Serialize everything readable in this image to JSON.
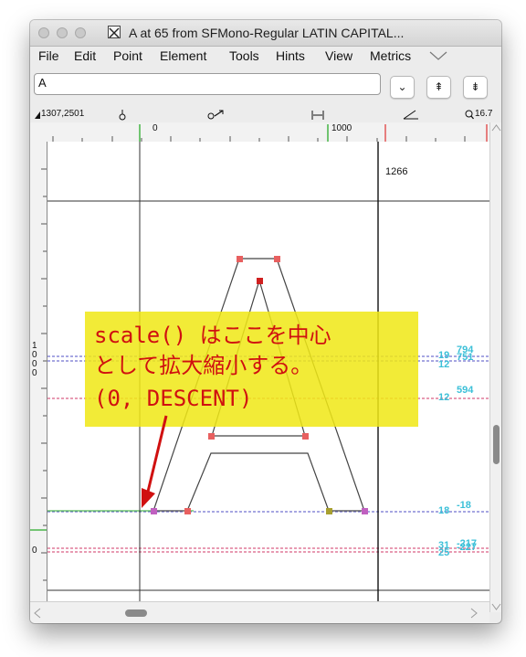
{
  "window": {
    "title": "A at 65 from SFMono-Regular LATIN CAPITAL..."
  },
  "menu": [
    "File",
    "Edit",
    "Point",
    "Element",
    "Tools",
    "Hints",
    "View",
    "Metrics"
  ],
  "toolbar": {
    "glyph_name": "A",
    "buttons": [
      "⌄",
      "⇞",
      "⇟"
    ]
  },
  "info": {
    "coords": "1307,2501",
    "zoom": "16.7"
  },
  "ruler": {
    "top_labels": [
      "0",
      "1000"
    ],
    "left_labels": [
      "1",
      "0",
      "0",
      "0",
      "0"
    ]
  },
  "canvas": {
    "advance_label": "1266",
    "metric_labels": [
      {
        "a": "19",
        "b": "794"
      },
      {
        "a": "12",
        "b": "751"
      },
      {
        "a": "12",
        "b": "594"
      },
      {
        "a": "18",
        "b": "-18"
      },
      {
        "a": "31",
        "b": "-217"
      },
      {
        "a": "25",
        "b": "-227"
      }
    ]
  },
  "callout": {
    "line1": "scale() はここを中心",
    "line2": "として拡大縮小する。",
    "line3": "(0, DESCENT)"
  },
  "colors": {
    "callout_bg": "#f0e816",
    "callout_text": "#d01010",
    "metric_cyan": "#3cc0d8",
    "guide_blue": "#8a8ad8",
    "guide_pink": "#e07a9a",
    "baseline_green": "#2aaa2a"
  }
}
